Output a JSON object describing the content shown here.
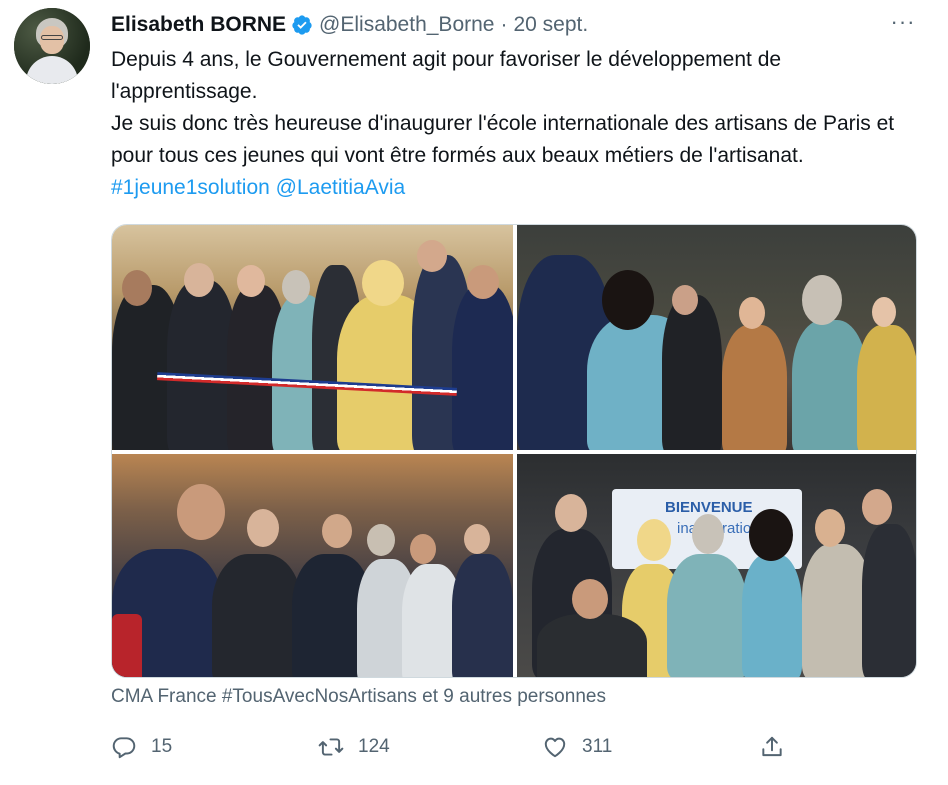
{
  "author": {
    "name": "Elisabeth BORNE",
    "handle": "@Elisabeth_Borne",
    "separator": "·",
    "date": "20 sept.",
    "verified": true,
    "avatar_icon": "profile-photo"
  },
  "more_icon": "ellipsis-icon",
  "more_label": "···",
  "text": {
    "line1": "Depuis 4 ans, le Gouvernement agit pour favoriser le développement de l'apprentissage.",
    "line2_prefix": "Je suis donc très heureuse d'inaugurer l'école internationale des artisans de Paris et pour tous ces jeunes qui vont être formés aux beaux métiers de l'artisanat. ",
    "hashtag": "#1jeune1solution",
    "mention": "@LaetitiaAvia"
  },
  "media": {
    "photo4_screen_text": "BIENVENUE",
    "photo4_screen_text2": "inauguration"
  },
  "likers": "CMA France #TousAvecNosArtisans et 9 autres personnes",
  "actions": {
    "reply": {
      "icon": "reply-icon",
      "count": "15"
    },
    "retweet": {
      "icon": "retweet-icon",
      "count": "124"
    },
    "like": {
      "icon": "heart-icon",
      "count": "311"
    },
    "share": {
      "icon": "share-icon"
    }
  },
  "colors": {
    "link": "#1d9bf0",
    "secondary_text": "#536471",
    "verified": "#1d9bf0"
  }
}
